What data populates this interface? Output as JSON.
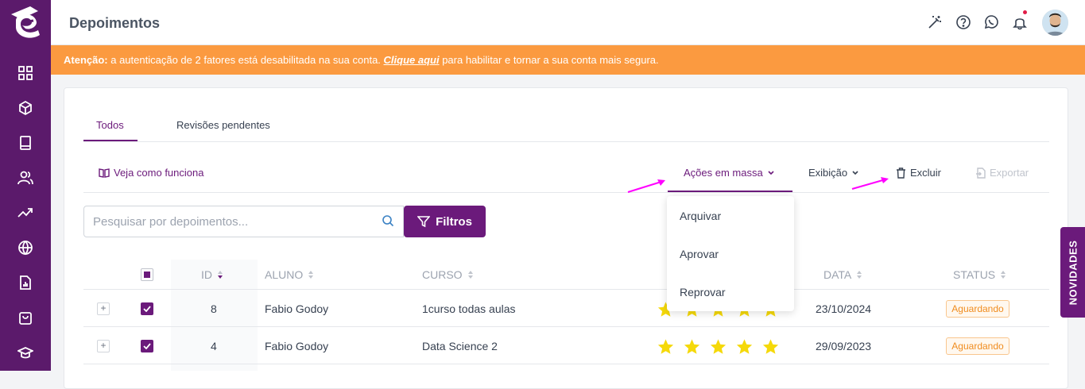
{
  "sidebar": {
    "icons": [
      "dashboard-icon",
      "cube-icon",
      "book-icon",
      "users-icon",
      "trending-icon",
      "globe-icon",
      "report-icon",
      "shopping-bag-icon",
      "graduation-cap-icon"
    ]
  },
  "header": {
    "title": "Depoimentos",
    "icons": [
      "magic-wand-icon",
      "help-icon",
      "whatsapp-icon",
      "bell-icon"
    ]
  },
  "warning": {
    "prefix": "Atenção:",
    "text_before": " a autenticação de 2 fatores está desabilitada na sua conta. ",
    "link": "Clique aqui",
    "text_after": " para habilitar e tornar a sua conta mais segura."
  },
  "tabs": [
    {
      "label": "Todos",
      "active": true
    },
    {
      "label": "Revisões pendentes",
      "active": false
    }
  ],
  "toolbar": {
    "how_it_works": "Veja como funciona",
    "bulk_actions": "Ações em massa",
    "display": "Exibição",
    "delete": "Excluir",
    "export": "Exportar"
  },
  "search": {
    "placeholder": "Pesquisar por depoimentos...",
    "filter_label": "Filtros"
  },
  "table": {
    "columns": [
      "ID",
      "ALUNO",
      "CURSO",
      "DATA",
      "STATUS"
    ],
    "rows": [
      {
        "id": "8",
        "aluno": "Fabio Godoy",
        "curso": "1curso todas aulas",
        "rating": 5,
        "data": "23/10/2024",
        "status": "Aguardando",
        "checked": true
      },
      {
        "id": "4",
        "aluno": "Fabio Godoy",
        "curso": "Data Science 2",
        "rating": 5,
        "data": "29/09/2023",
        "status": "Aguardando",
        "checked": true
      }
    ]
  },
  "bulk_menu": {
    "items": [
      "Arquivar",
      "Aprovar",
      "Reprovar"
    ]
  },
  "side_tab": {
    "label": "NOVIDADES"
  },
  "colors": {
    "primary": "#6b1a7b",
    "sidebar": "#5b1a6b",
    "warning": "#fb9a40",
    "star": "#f5d90a",
    "annotation_arrow": "#ff00ff"
  }
}
